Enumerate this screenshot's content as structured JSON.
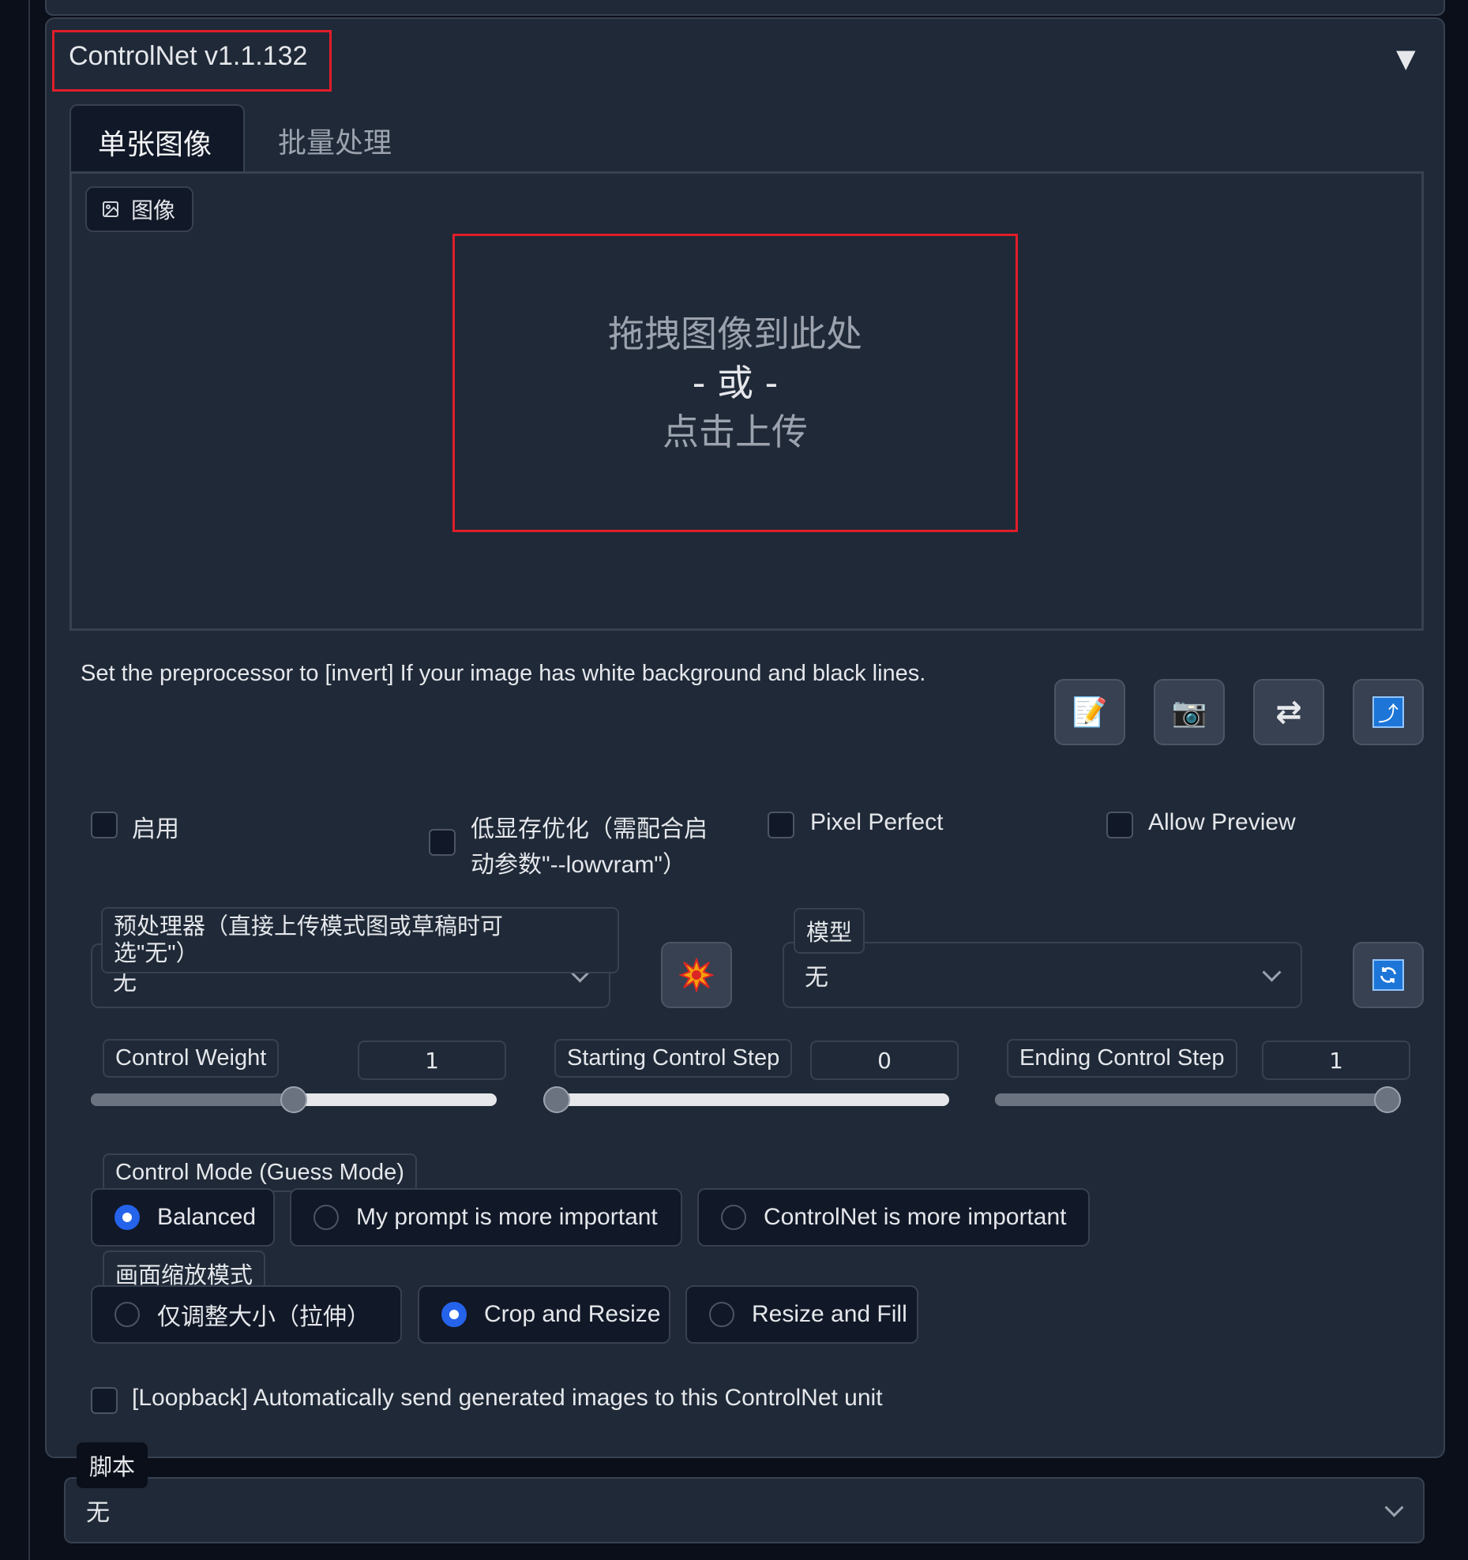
{
  "header": {
    "title": "ControlNet v1.1.132",
    "collapse_glyph": "▼"
  },
  "tabs": [
    {
      "label": "单张图像",
      "active": true
    },
    {
      "label": "批量处理",
      "active": false
    }
  ],
  "image_panel": {
    "label": "图像",
    "drop_line1": "拖拽图像到此处",
    "drop_line2": "- 或 -",
    "drop_line3": "点击上传"
  },
  "hint": "Set the preprocessor to [invert] If your image has white background and black lines.",
  "tool_buttons": [
    {
      "name": "memo-icon",
      "glyph": "📝"
    },
    {
      "name": "camera-icon",
      "glyph": "📷"
    },
    {
      "name": "swap-icon",
      "glyph": "⇄"
    },
    {
      "name": "upload-icon",
      "glyph": "⤴"
    }
  ],
  "checkboxes": {
    "enable": "启用",
    "lowvram_line1": "低显存优化（需配合启",
    "lowvram_line2": "动参数\"--lowvram\"）",
    "pixel_perfect": "Pixel Perfect",
    "allow_preview": "Allow Preview"
  },
  "preprocessor": {
    "label_line1": "预处理器（直接上传模式图或草稿时可",
    "label_line2": "选\"无\"）",
    "value": "无"
  },
  "model": {
    "label": "模型",
    "value": "无"
  },
  "sliders": {
    "control_weight": {
      "label": "Control Weight",
      "value": "1",
      "fraction": 0.5
    },
    "starting_step": {
      "label": "Starting Control Step",
      "value": "0",
      "fraction": 0.0
    },
    "ending_step": {
      "label": "Ending Control Step",
      "value": "1",
      "fraction": 1.0
    }
  },
  "control_mode": {
    "label": "Control Mode (Guess Mode)",
    "options": [
      "Balanced",
      "My prompt is more important",
      "ControlNet is more important"
    ],
    "selected": "Balanced"
  },
  "resize_mode": {
    "label": "画面缩放模式",
    "options": [
      "仅调整大小（拉伸）",
      "Crop and Resize",
      "Resize and Fill"
    ],
    "selected": "Crop and Resize"
  },
  "loopback": "[Loopback] Automatically send generated images to this ControlNet unit",
  "script": {
    "label": "脚本",
    "value": "无"
  },
  "colors": {
    "accent": "#2563eb",
    "highlight_border": "#e11d2b",
    "panel": "#1f2937"
  }
}
